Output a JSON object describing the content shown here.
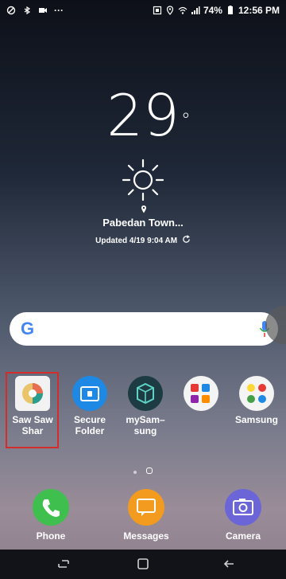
{
  "status_bar": {
    "dots": "···",
    "battery": "74%",
    "time": "12:56 PM"
  },
  "weather": {
    "temperature": "29",
    "degree": "°",
    "location": "Pabedan Town...",
    "updated": "Updated 4/19 9:04 AM"
  },
  "search": {
    "logo": "G"
  },
  "apps": [
    {
      "name": "app-saw-saw-shar",
      "label_line1": "Saw Saw",
      "label_line2": "Shar"
    },
    {
      "name": "app-secure-folder",
      "label_line1": "Secure",
      "label_line2": "Folder"
    },
    {
      "name": "app-mysamsung",
      "label_line1": "mySam–",
      "label_line2": "sung"
    },
    {
      "name": "app-folder",
      "label_line1": "",
      "label_line2": ""
    },
    {
      "name": "app-samsung-folder",
      "label_line1": "Samsung",
      "label_line2": ""
    }
  ],
  "dock": [
    {
      "label": "Phone"
    },
    {
      "label": "Messages"
    },
    {
      "label": "Camera"
    }
  ],
  "colors": {
    "selection": "#d42b2b",
    "phone": "#3fbf4e",
    "messages": "#f39b1e",
    "camera": "#6b65d8",
    "secure_folder": "#1e88e5",
    "mysamsung": "#1c3b43"
  }
}
